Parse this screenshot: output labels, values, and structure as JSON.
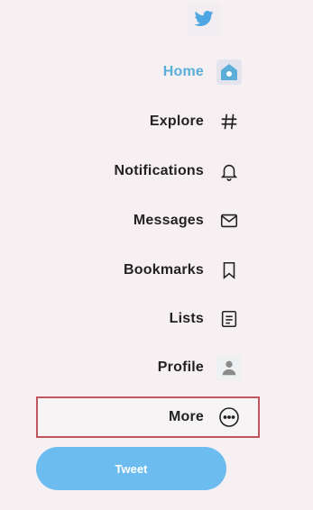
{
  "nav": {
    "logo_icon": "twitter-bird-icon",
    "items": [
      {
        "id": "home",
        "label": "Home",
        "icon": "home-icon",
        "active": true
      },
      {
        "id": "explore",
        "label": "Explore",
        "icon": "hashtag-icon",
        "active": false
      },
      {
        "id": "notifications",
        "label": "Notifications",
        "icon": "bell-icon",
        "active": false
      },
      {
        "id": "messages",
        "label": "Messages",
        "icon": "envelope-icon",
        "active": false
      },
      {
        "id": "bookmarks",
        "label": "Bookmarks",
        "icon": "bookmark-icon",
        "active": false
      },
      {
        "id": "lists",
        "label": "Lists",
        "icon": "list-icon",
        "active": false
      },
      {
        "id": "profile",
        "label": "Profile",
        "icon": "user-icon",
        "active": false
      },
      {
        "id": "more",
        "label": "More",
        "icon": "more-icon",
        "active": false
      }
    ]
  },
  "tweet_button": {
    "label": "Tweet"
  },
  "colors": {
    "accent": "#5aaed8",
    "tweet_bg": "#6cbcf0",
    "highlight_border": "#c0565f",
    "background": "#f6f0f3"
  }
}
